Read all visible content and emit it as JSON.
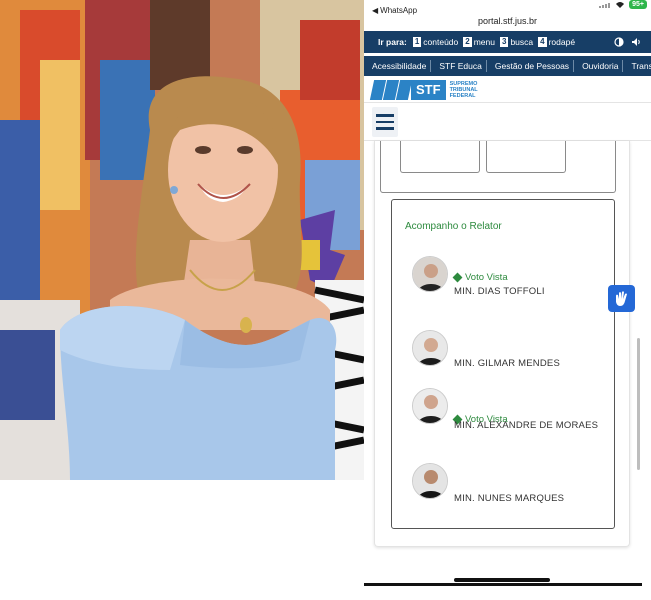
{
  "status_bar": {
    "back_app": "WhatsApp",
    "battery": "95+"
  },
  "browser": {
    "url": "portal.stf.jus.br"
  },
  "skip_bar": {
    "label": "Ir para:",
    "links": [
      {
        "key": "1",
        "label": "conteúdo"
      },
      {
        "key": "2",
        "label": "menu"
      },
      {
        "key": "3",
        "label": "busca"
      },
      {
        "key": "4",
        "label": "rodapé"
      }
    ]
  },
  "top_nav": {
    "items": [
      "Acessibilidade",
      "STF Educa",
      "Gestão de Pessoas",
      "Ouvidoria",
      "Transpar"
    ]
  },
  "brand": {
    "abbr": "STF",
    "line1": "SUPREMO",
    "line2": "TRIBUNAL",
    "line3": "FEDERAL"
  },
  "relator_panel": {
    "title": "Acompanho o Relator",
    "ministers": [
      {
        "name": "MIN. DIAS TOFFOLI",
        "voto": "Voto Vista"
      },
      {
        "name": "MIN. GILMAR MENDES",
        "voto": ""
      },
      {
        "name": "MIN. ALEXANDRE DE MORAES",
        "voto": "Voto Vista"
      },
      {
        "name": "MIN. NUNES MARQUES",
        "voto": ""
      }
    ]
  },
  "colors": {
    "navy": "#173e66",
    "stf_blue": "#2b83c6",
    "green": "#2d8a3e",
    "libras_blue": "#2468d6"
  },
  "icons": [
    "contrast-icon",
    "sound-icon",
    "hamburger-menu-icon",
    "libras-hands-icon",
    "wifi-icon",
    "signal-icon"
  ]
}
